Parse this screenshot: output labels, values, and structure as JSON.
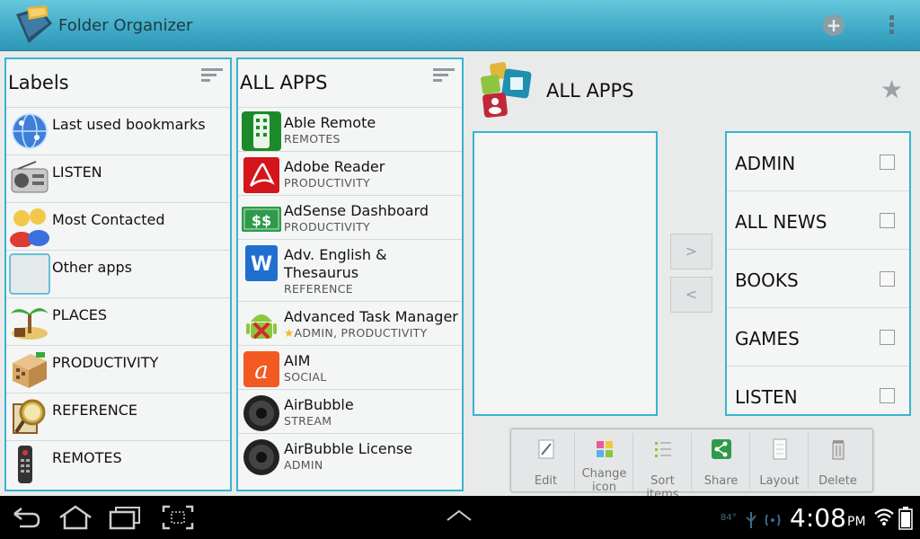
{
  "app": {
    "title": "Folder Organizer"
  },
  "labels_panel": {
    "title": "Labels",
    "items": [
      {
        "label": "Last used bookmarks",
        "icon": "globe-icon"
      },
      {
        "label": "LISTEN",
        "icon": "radio-icon"
      },
      {
        "label": "Most Contacted",
        "icon": "people-icon"
      },
      {
        "label": "Other apps",
        "icon": "blank-icon"
      },
      {
        "label": "PLACES",
        "icon": "palm-island-icon"
      },
      {
        "label": "PRODUCTIVITY",
        "icon": "building-icon"
      },
      {
        "label": "REFERENCE",
        "icon": "magnifier-icon"
      },
      {
        "label": "REMOTES",
        "icon": "remote-icon"
      }
    ]
  },
  "apps_panel": {
    "title": "ALL APPS",
    "items": [
      {
        "name": "Able Remote",
        "category": "REMOTES"
      },
      {
        "name": "Adobe Reader",
        "category": "PRODUCTIVITY"
      },
      {
        "name": "AdSense Dashboard",
        "category": "PRODUCTIVITY"
      },
      {
        "name": "Adv. English & Thesaurus",
        "category": "REFERENCE"
      },
      {
        "name": "Advanced Task Manager",
        "category": "ADMIN, PRODUCTIVITY"
      },
      {
        "name": "AIM",
        "category": "SOCIAL"
      },
      {
        "name": "AirBubble",
        "category": "STREAM"
      },
      {
        "name": "AirBubble License",
        "category": "ADMIN"
      }
    ]
  },
  "detail": {
    "title": "ALL APPS",
    "move_right": ">",
    "move_left": "<",
    "categories": [
      "ADMIN",
      "ALL NEWS",
      "BOOKS",
      "GAMES",
      "LISTEN"
    ]
  },
  "toolbar": {
    "edit": "Edit",
    "change_icon": "Change icon",
    "sort_items": "Sort items",
    "share": "Share",
    "layout": "Layout",
    "delete": "Delete"
  },
  "status": {
    "time": "4:08",
    "ampm": "PM",
    "temperature": "84°"
  },
  "colors": {
    "accent": "#38b4d0",
    "actionbar": "#3fa9c7"
  }
}
